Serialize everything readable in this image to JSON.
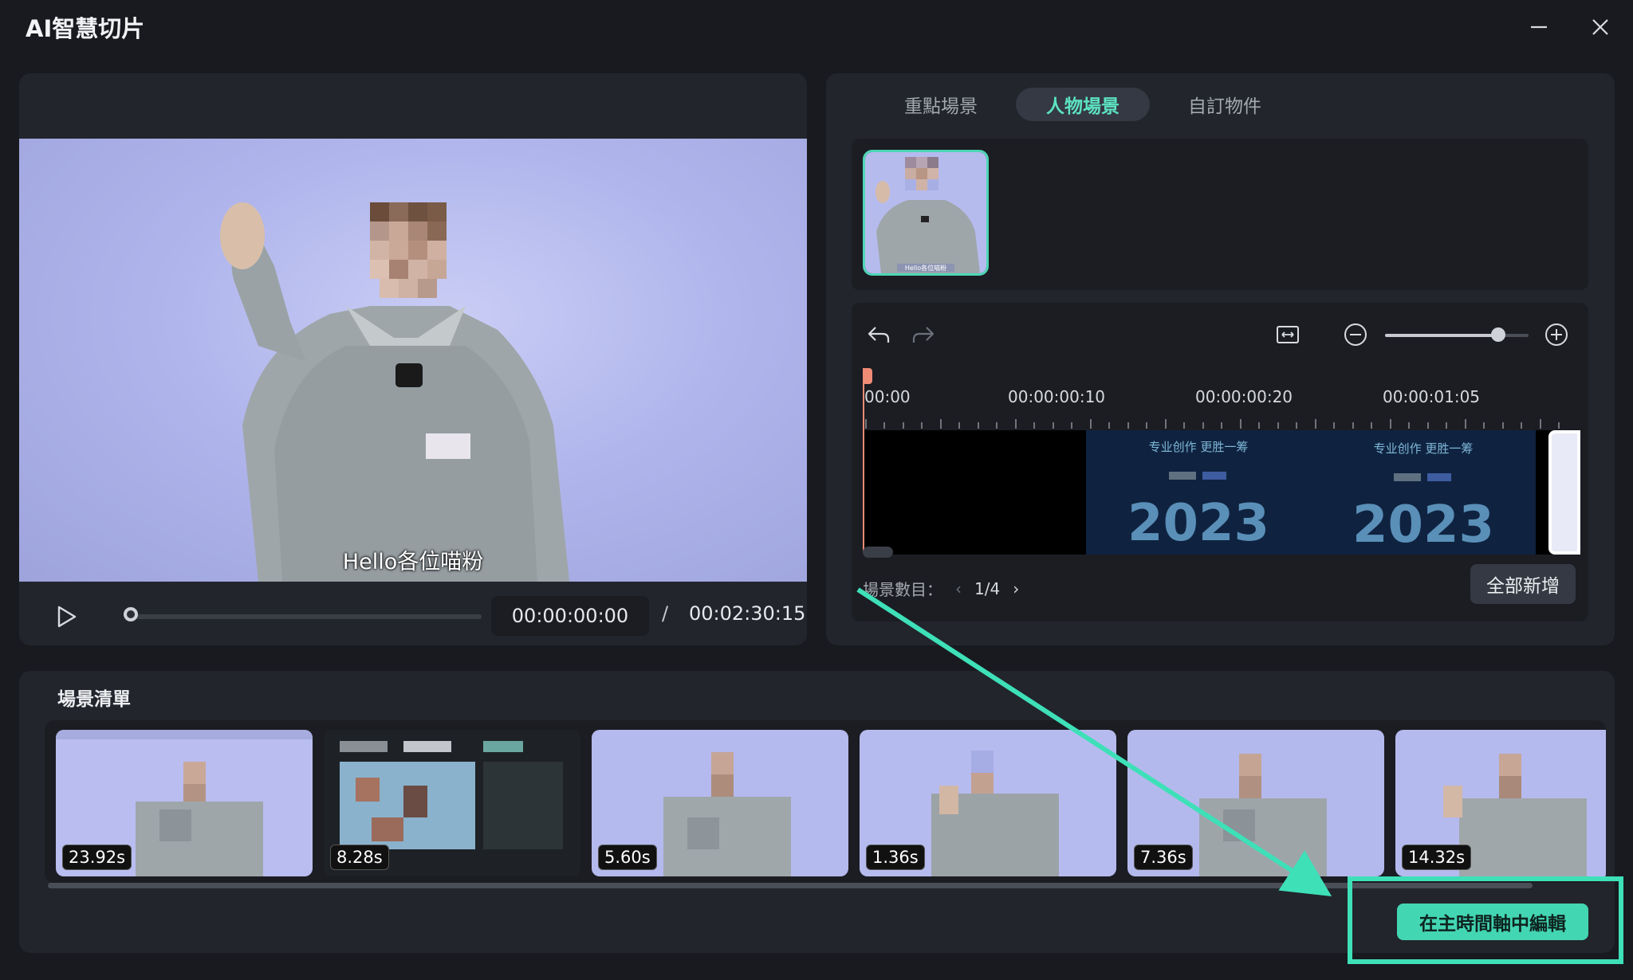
{
  "window": {
    "title": "AI智慧切片"
  },
  "preview": {
    "subtitle": "Hello各位喵粉",
    "current_time": "00:00:00:00",
    "separator": "/",
    "total_time": "00:02:30:15",
    "progress": 0
  },
  "scene_panel": {
    "tabs": [
      {
        "label": "重點場景",
        "active": false
      },
      {
        "label": "人物場景",
        "active": true
      },
      {
        "label": "自訂物件",
        "active": false
      }
    ],
    "character_thumb_caption": "Hello各位喵粉",
    "timeline": {
      "ruler_labels": [
        "00:00",
        "00:00:00:10",
        "00:00:00:20",
        "00:00:01:05"
      ],
      "clip_text_line1": "专业创作 更胜一筹",
      "clip_text_year": "2023",
      "zoom_level": 0.79
    },
    "scene_count_label": "場景數目：",
    "scene_count_value": "1/4",
    "add_all_label": "全部新增"
  },
  "scene_list": {
    "title": "場景清單",
    "scenes": [
      {
        "duration": "23.92s"
      },
      {
        "duration": "8.28s"
      },
      {
        "duration": "5.60s"
      },
      {
        "duration": "1.36s"
      },
      {
        "duration": "7.36s"
      },
      {
        "duration": "14.32s"
      }
    ],
    "edit_in_timeline_label": "在主時間軸中編輯"
  },
  "colors": {
    "accent": "#43d6b2",
    "annotation": "#3ee0b8",
    "background": "#181a1f",
    "panel": "#22252c",
    "playhead": "#f08b76"
  },
  "icons": [
    "minimize-icon",
    "close-icon",
    "play-icon",
    "undo-icon",
    "redo-icon",
    "fit-icon",
    "zoom-out-icon",
    "zoom-in-icon",
    "chevron-left-icon",
    "chevron-right-icon"
  ]
}
